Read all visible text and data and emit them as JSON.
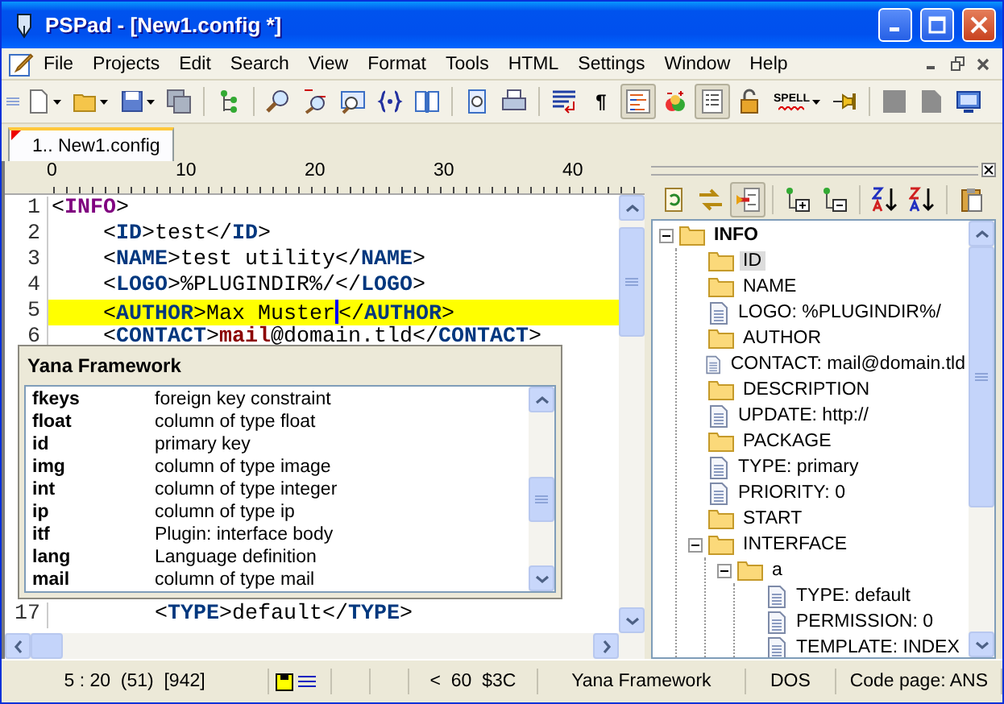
{
  "window": {
    "title": "PSPad - [New1.config *]"
  },
  "menu": [
    "File",
    "Projects",
    "Edit",
    "Search",
    "View",
    "Format",
    "Tools",
    "HTML",
    "Settings",
    "Window",
    "Help"
  ],
  "toolbar": [
    {
      "kind": "new",
      "dropdown": true,
      "pressed": false
    },
    {
      "kind": "open",
      "dropdown": true,
      "pressed": false
    },
    {
      "kind": "save",
      "dropdown": true,
      "pressed": false
    },
    {
      "kind": "save-all",
      "dropdown": false,
      "pressed": false
    },
    {
      "kind": "separator"
    },
    {
      "kind": "tree",
      "dropdown": false,
      "pressed": false
    },
    {
      "kind": "separator"
    },
    {
      "kind": "search",
      "dropdown": false,
      "pressed": false
    },
    {
      "kind": "replace",
      "dropdown": false,
      "pressed": false
    },
    {
      "kind": "find-files",
      "dropdown": false,
      "pressed": false
    },
    {
      "kind": "braces",
      "dropdown": false,
      "pressed": false
    },
    {
      "kind": "book",
      "dropdown": false,
      "pressed": false
    },
    {
      "kind": "separator"
    },
    {
      "kind": "preview",
      "dropdown": false,
      "pressed": false
    },
    {
      "kind": "print",
      "dropdown": false,
      "pressed": false
    },
    {
      "kind": "separator"
    },
    {
      "kind": "wrap",
      "dropdown": false,
      "pressed": false
    },
    {
      "kind": "pilcrow",
      "label": "¶",
      "dropdown": false,
      "pressed": false
    },
    {
      "kind": "highlight",
      "dropdown": false,
      "pressed": true
    },
    {
      "kind": "code",
      "dropdown": false,
      "pressed": false
    },
    {
      "kind": "list",
      "dropdown": false,
      "pressed": true
    },
    {
      "kind": "lock",
      "dropdown": false,
      "pressed": false
    },
    {
      "kind": "spell",
      "label": "SPELL",
      "dropdown": true,
      "pressed": false
    },
    {
      "kind": "pin",
      "dropdown": false,
      "pressed": false
    },
    {
      "kind": "separator"
    },
    {
      "kind": "gray-square",
      "dropdown": false,
      "pressed": false
    },
    {
      "kind": "gray-doc",
      "dropdown": false,
      "pressed": false
    },
    {
      "kind": "monitor",
      "dropdown": false,
      "pressed": false
    }
  ],
  "tabs": [
    {
      "label": "1.. New1.config",
      "selected": true,
      "modified": true
    }
  ],
  "ruler": [
    "0",
    "10",
    "20",
    "30",
    "40"
  ],
  "editor": {
    "lines": [
      {
        "number": "1",
        "current": false,
        "segments": [
          {
            "kind": "plain",
            "text": "<"
          },
          {
            "kind": "root",
            "text": "INFO"
          },
          {
            "kind": "plain",
            "text": ">"
          }
        ]
      },
      {
        "number": "2",
        "current": false,
        "segments": [
          {
            "kind": "plain",
            "text": "    <"
          },
          {
            "kind": "tag",
            "text": "ID"
          },
          {
            "kind": "plain",
            "text": ">test</"
          },
          {
            "kind": "tag",
            "text": "ID"
          },
          {
            "kind": "plain",
            "text": ">"
          }
        ]
      },
      {
        "number": "3",
        "current": false,
        "segments": [
          {
            "kind": "plain",
            "text": "    <"
          },
          {
            "kind": "tag",
            "text": "NAME"
          },
          {
            "kind": "plain",
            "text": ">test utility</"
          },
          {
            "kind": "tag",
            "text": "NAME"
          },
          {
            "kind": "plain",
            "text": ">"
          }
        ]
      },
      {
        "number": "4",
        "current": false,
        "segments": [
          {
            "kind": "plain",
            "text": "    <"
          },
          {
            "kind": "tag",
            "text": "LOGO"
          },
          {
            "kind": "plain",
            "text": ">%PLUGINDIR%/</"
          },
          {
            "kind": "tag",
            "text": "LOGO"
          },
          {
            "kind": "plain",
            "text": ">"
          }
        ]
      },
      {
        "number": "5",
        "current": true,
        "segments": [
          {
            "kind": "plain",
            "text": "    <"
          },
          {
            "kind": "tag",
            "text": "AUTHOR"
          },
          {
            "kind": "plain",
            "text": ">Max Muster"
          },
          {
            "kind": "caret"
          },
          {
            "kind": "plain",
            "text": "</"
          },
          {
            "kind": "tag",
            "text": "AUTHOR"
          },
          {
            "kind": "plain",
            "text": ">"
          }
        ]
      },
      {
        "number": "6",
        "current": false,
        "segments": [
          {
            "kind": "plain",
            "text": "    <"
          },
          {
            "kind": "tag",
            "text": "CONTACT"
          },
          {
            "kind": "plain",
            "text": ">"
          },
          {
            "kind": "keyword",
            "text": "mail"
          },
          {
            "kind": "plain",
            "text": "@domain.tld</"
          },
          {
            "kind": "tag",
            "text": "CONTACT"
          },
          {
            "kind": "plain",
            "text": ">"
          }
        ]
      },
      {
        "number": "17",
        "current": false,
        "segments": [
          {
            "kind": "plain",
            "text": "        <"
          },
          {
            "kind": "tag",
            "text": "TYPE"
          },
          {
            "kind": "plain",
            "text": ">default</"
          },
          {
            "kind": "tag",
            "text": "TYPE"
          },
          {
            "kind": "plain",
            "text": ">"
          }
        ]
      }
    ]
  },
  "completion": {
    "title": "Yana Framework",
    "items": [
      {
        "keyword": "fkeys",
        "description": "foreign key constraint"
      },
      {
        "keyword": "float",
        "description": "column of type float"
      },
      {
        "keyword": "id",
        "description": "primary key"
      },
      {
        "keyword": "img",
        "description": "column of type image"
      },
      {
        "keyword": "int",
        "description": "column of type integer"
      },
      {
        "keyword": "ip",
        "description": "column of type ip"
      },
      {
        "keyword": "itf",
        "description": "Plugin: interface body"
      },
      {
        "keyword": "lang",
        "description": "Language definition"
      },
      {
        "keyword": "mail",
        "description": "column of type mail"
      }
    ]
  },
  "side_toolbar": [
    {
      "kind": "refresh",
      "pressed": false
    },
    {
      "kind": "swap",
      "pressed": false
    },
    {
      "kind": "collapse",
      "pressed": true
    },
    {
      "kind": "separator"
    },
    {
      "kind": "add-node",
      "pressed": false
    },
    {
      "kind": "remove-node",
      "pressed": false
    },
    {
      "kind": "separator"
    },
    {
      "kind": "sort-az",
      "pressed": false
    },
    {
      "kind": "sort-za",
      "pressed": false
    },
    {
      "kind": "separator"
    },
    {
      "kind": "clipboard",
      "pressed": false
    }
  ],
  "tree": [
    {
      "label": "INFO",
      "kind": "folder",
      "expanded": true,
      "selected": false,
      "children": [
        {
          "label": "ID",
          "kind": "folder",
          "selected": true
        },
        {
          "label": "NAME",
          "kind": "folder",
          "selected": false
        },
        {
          "label": "LOGO: %PLUGINDIR%/",
          "kind": "file",
          "selected": false
        },
        {
          "label": "AUTHOR",
          "kind": "folder",
          "selected": false
        },
        {
          "label": "CONTACT: mail@domain.tld",
          "kind": "file",
          "selected": false
        },
        {
          "label": "DESCRIPTION",
          "kind": "folder",
          "selected": false
        },
        {
          "label": "UPDATE: http://",
          "kind": "file",
          "selected": false
        },
        {
          "label": "PACKAGE",
          "kind": "folder",
          "selected": false
        },
        {
          "label": "TYPE: primary",
          "kind": "file",
          "selected": false
        },
        {
          "label": "PRIORITY: 0",
          "kind": "file",
          "selected": false
        },
        {
          "label": "START",
          "kind": "folder",
          "selected": false
        },
        {
          "label": "INTERFACE",
          "kind": "folder",
          "expanded": true,
          "selected": false,
          "children": [
            {
              "label": "a",
              "kind": "folder",
              "expanded": true,
              "selected": false,
              "children": [
                {
                  "label": "TYPE: default",
                  "kind": "file",
                  "selected": false
                },
                {
                  "label": "PERMISSION: 0",
                  "kind": "file",
                  "selected": false
                },
                {
                  "label": "TEMPLATE: INDEX",
                  "kind": "file",
                  "selected": false
                }
              ]
            }
          ]
        }
      ]
    }
  ],
  "status_bar": {
    "position": "5 : 20  (51)  [942]",
    "character": "<  60  $3C",
    "highlighter": "Yana Framework",
    "line_end": "DOS",
    "code_page": "Code page: ANS"
  }
}
